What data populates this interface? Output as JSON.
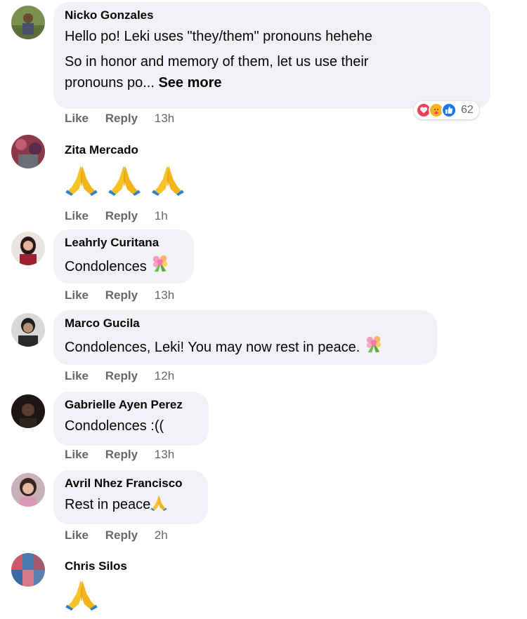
{
  "actions": {
    "like": "Like",
    "reply": "Reply"
  },
  "comments": [
    {
      "name": "Nicko Gonzales",
      "lines": [
        "Hello po! Leki uses \"they/them\" pronouns hehehe",
        "So in honor and memory of them, let us use their",
        "pronouns po..."
      ],
      "see_more": "See more",
      "time": "13h",
      "reaction_icons": [
        "love-icon",
        "care-icon",
        "like-icon"
      ],
      "reaction_count": "62"
    },
    {
      "name": "Zita Mercado",
      "emoji": [
        "praying-hands",
        "praying-hands",
        "praying-hands"
      ],
      "time": "1h"
    },
    {
      "name": "Leahrly Curitana",
      "text": "Condolences",
      "emoji": [
        "bouquet"
      ],
      "time": "13h"
    },
    {
      "name": "Marco Gucila",
      "text": "Condolences, Leki! You may now rest in peace.",
      "emoji": [
        "bouquet"
      ],
      "time": "12h"
    },
    {
      "name": "Gabrielle Ayen Perez",
      "text": "Condolences :((",
      "time": "13h"
    },
    {
      "name": "Avril Nhez Francisco",
      "text": "Rest in peace",
      "emoji": [
        "praying-hands"
      ],
      "time": "2h"
    },
    {
      "name": "Chris Silos",
      "emoji": [
        "praying-hands"
      ]
    }
  ],
  "colors": {
    "bubble": "#f0f2f5",
    "meta": "#65676b",
    "like": "#1877f2",
    "love": "#f33e58",
    "care": "#f7b125"
  }
}
